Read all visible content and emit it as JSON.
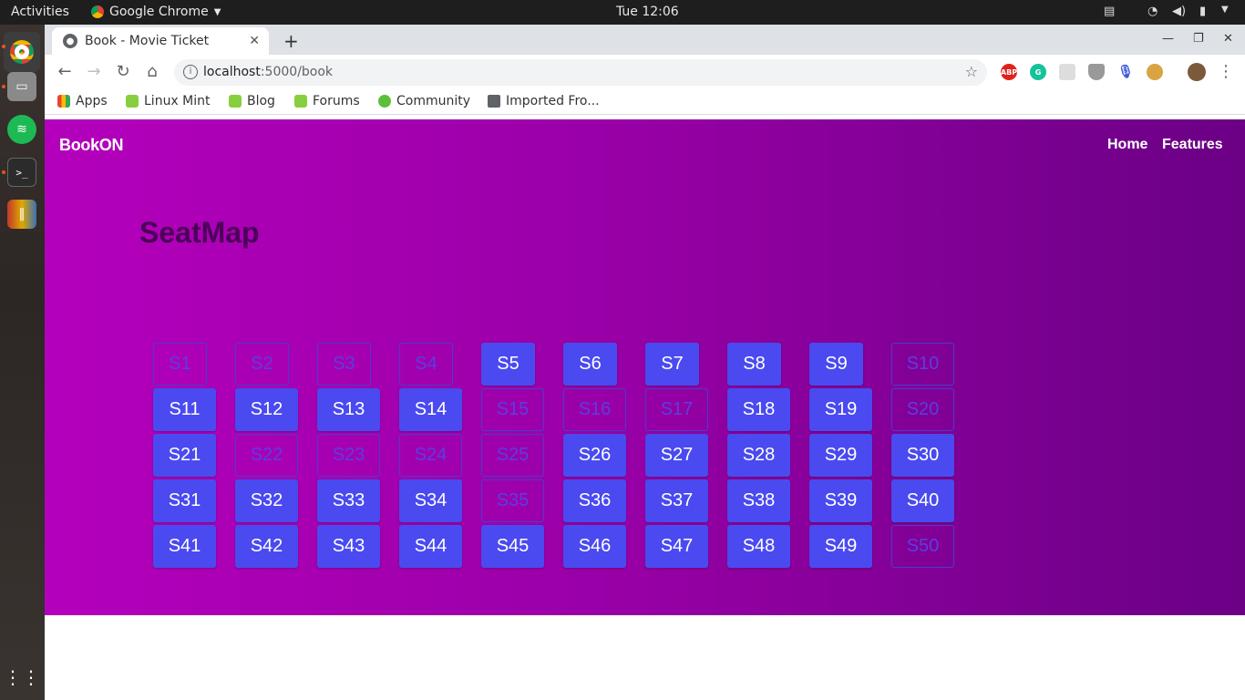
{
  "system": {
    "activities": "Activities",
    "app_name": "Google Chrome",
    "clock": "Tue 12:06"
  },
  "browser": {
    "tab_title": "Book - Movie Ticket",
    "url_host": "localhost",
    "url_rest": ":5000/book",
    "bookmarks": [
      "Apps",
      "Linux Mint",
      "Blog",
      "Forums",
      "Community",
      "Imported Fro..."
    ],
    "extensions": [
      "ABP",
      "G"
    ]
  },
  "site": {
    "brand": "BookON",
    "nav": [
      "Home",
      "Features"
    ],
    "heading": "SeatMap"
  },
  "seats": [
    {
      "label": "S1",
      "status": "booked"
    },
    {
      "label": "S2",
      "status": "booked"
    },
    {
      "label": "S3",
      "status": "booked"
    },
    {
      "label": "S4",
      "status": "booked"
    },
    {
      "label": "S5",
      "status": "available"
    },
    {
      "label": "S6",
      "status": "available"
    },
    {
      "label": "S7",
      "status": "available"
    },
    {
      "label": "S8",
      "status": "available"
    },
    {
      "label": "S9",
      "status": "available"
    },
    {
      "label": "S10",
      "status": "booked"
    },
    {
      "label": "S11",
      "status": "available"
    },
    {
      "label": "S12",
      "status": "available"
    },
    {
      "label": "S13",
      "status": "available"
    },
    {
      "label": "S14",
      "status": "available"
    },
    {
      "label": "S15",
      "status": "booked"
    },
    {
      "label": "S16",
      "status": "booked"
    },
    {
      "label": "S17",
      "status": "booked"
    },
    {
      "label": "S18",
      "status": "available"
    },
    {
      "label": "S19",
      "status": "available"
    },
    {
      "label": "S20",
      "status": "booked"
    },
    {
      "label": "S21",
      "status": "available"
    },
    {
      "label": "S22",
      "status": "booked"
    },
    {
      "label": "S23",
      "status": "booked"
    },
    {
      "label": "S24",
      "status": "booked"
    },
    {
      "label": "S25",
      "status": "booked"
    },
    {
      "label": "S26",
      "status": "available"
    },
    {
      "label": "S27",
      "status": "available"
    },
    {
      "label": "S28",
      "status": "available"
    },
    {
      "label": "S29",
      "status": "available"
    },
    {
      "label": "S30",
      "status": "available"
    },
    {
      "label": "S31",
      "status": "available"
    },
    {
      "label": "S32",
      "status": "available"
    },
    {
      "label": "S33",
      "status": "available"
    },
    {
      "label": "S34",
      "status": "available"
    },
    {
      "label": "S35",
      "status": "booked"
    },
    {
      "label": "S36",
      "status": "available"
    },
    {
      "label": "S37",
      "status": "available"
    },
    {
      "label": "S38",
      "status": "available"
    },
    {
      "label": "S39",
      "status": "available"
    },
    {
      "label": "S40",
      "status": "available"
    },
    {
      "label": "S41",
      "status": "available"
    },
    {
      "label": "S42",
      "status": "available"
    },
    {
      "label": "S43",
      "status": "available"
    },
    {
      "label": "S44",
      "status": "available"
    },
    {
      "label": "S45",
      "status": "available"
    },
    {
      "label": "S46",
      "status": "available"
    },
    {
      "label": "S47",
      "status": "available"
    },
    {
      "label": "S48",
      "status": "available"
    },
    {
      "label": "S49",
      "status": "available"
    },
    {
      "label": "S50",
      "status": "booked"
    }
  ],
  "colors": {
    "hero_left": "#b400bc",
    "hero_right": "#6b0085",
    "seat_available": "#4a4af0",
    "seat_booked_border": "#4b3ccc"
  }
}
